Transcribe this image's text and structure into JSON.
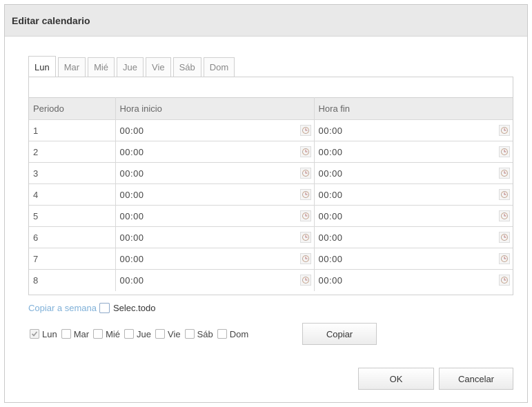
{
  "dialog": {
    "title": "Editar calendario"
  },
  "tabs": [
    {
      "label": "Lun",
      "active": true
    },
    {
      "label": "Mar",
      "active": false
    },
    {
      "label": "Mié",
      "active": false
    },
    {
      "label": "Jue",
      "active": false
    },
    {
      "label": "Vie",
      "active": false
    },
    {
      "label": "Sáb",
      "active": false
    },
    {
      "label": "Dom",
      "active": false
    }
  ],
  "table": {
    "headers": [
      "Periodo",
      "Hora inicio",
      "Hora fin"
    ],
    "rows": [
      {
        "period": "1",
        "start": "00:00",
        "end": "00:00"
      },
      {
        "period": "2",
        "start": "00:00",
        "end": "00:00"
      },
      {
        "period": "3",
        "start": "00:00",
        "end": "00:00"
      },
      {
        "period": "4",
        "start": "00:00",
        "end": "00:00"
      },
      {
        "period": "5",
        "start": "00:00",
        "end": "00:00"
      },
      {
        "period": "6",
        "start": "00:00",
        "end": "00:00"
      },
      {
        "period": "7",
        "start": "00:00",
        "end": "00:00"
      },
      {
        "period": "8",
        "start": "00:00",
        "end": "00:00"
      }
    ]
  },
  "copy": {
    "link_label": "Copiar a semana",
    "select_all_label": "Selec.todo",
    "days": [
      {
        "label": "Lun",
        "checked": true
      },
      {
        "label": "Mar",
        "checked": false
      },
      {
        "label": "Mié",
        "checked": false
      },
      {
        "label": "Jue",
        "checked": false
      },
      {
        "label": "Vie",
        "checked": false
      },
      {
        "label": "Sáb",
        "checked": false
      },
      {
        "label": "Dom",
        "checked": false
      }
    ],
    "copy_button": "Copiar"
  },
  "footer": {
    "ok": "OK",
    "cancel": "Cancelar"
  },
  "colors": {
    "link": "#7fb0d8",
    "header_bg": "#ececec",
    "title_bg": "#e9e9e9"
  },
  "icons": {
    "time_picker": "clock-icon",
    "check": "check-icon"
  }
}
